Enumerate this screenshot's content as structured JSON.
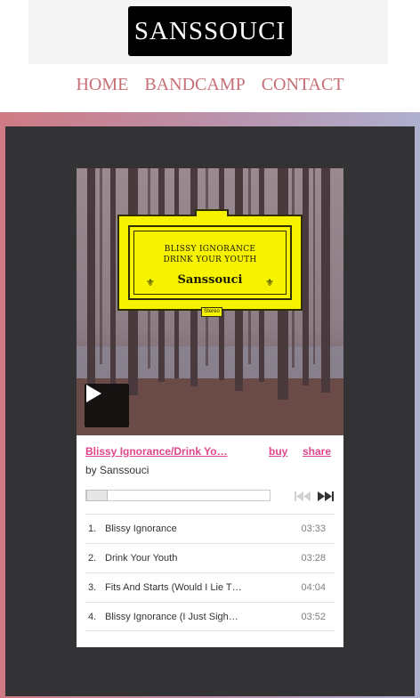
{
  "site": {
    "logo_text": "SANSSOUCI",
    "nav": [
      "HOME",
      "BANDCAMP",
      "CONTACT"
    ]
  },
  "colors": {
    "nav_link": "#c76f76",
    "accent": "#e0468b",
    "frame_dark": "#333336",
    "label_yellow": "#f7f300"
  },
  "player": {
    "artwork": {
      "line1": "BLISSY IGNORANCE",
      "line2": "DRINK YOUR YOUTH",
      "artist": "Sanssouci",
      "stereo": "Stereo"
    },
    "album_title": "Blissy Ignorance/Drink Yo…",
    "buy_label": "buy",
    "share_label": "share",
    "byline": "by Sanssouci",
    "progress": 0,
    "tracks": [
      {
        "num": "1.",
        "title": "Blissy Ignorance",
        "duration": "03:33"
      },
      {
        "num": "2.",
        "title": "Drink Your Youth",
        "duration": "03:28"
      },
      {
        "num": "3.",
        "title": "Fits And Starts (Would I Lie T…",
        "duration": "04:04"
      },
      {
        "num": "4.",
        "title": "Blissy Ignorance (I Just Sigh…",
        "duration": "03:52"
      }
    ],
    "icons": {
      "play": "play-icon",
      "prev": "skip-back-icon",
      "next": "skip-forward-icon"
    }
  }
}
